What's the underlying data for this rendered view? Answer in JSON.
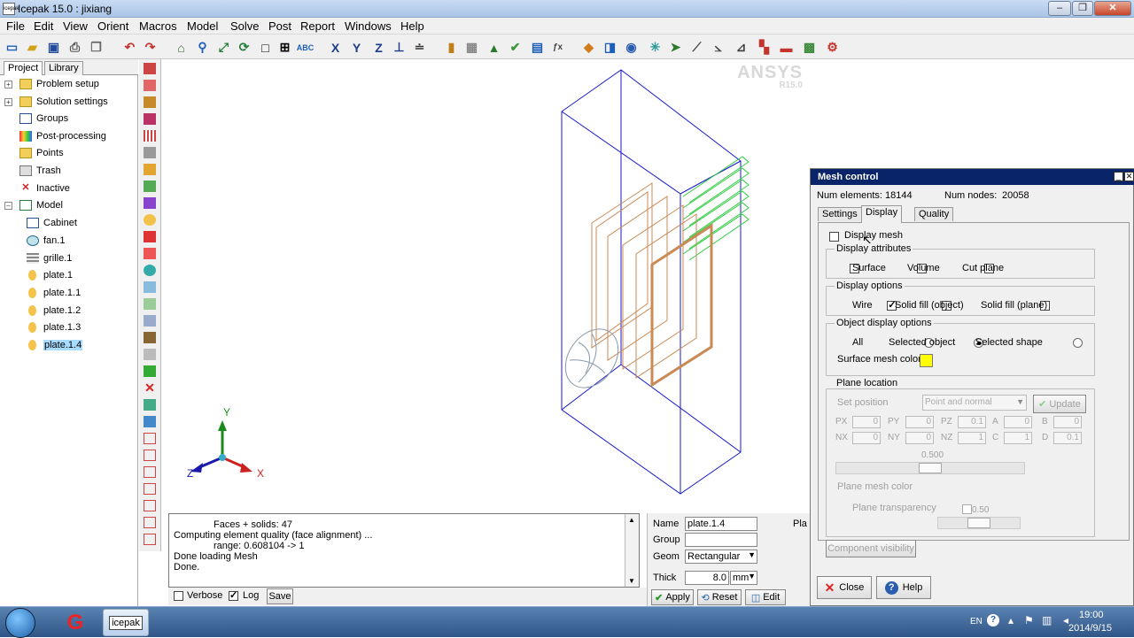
{
  "window": {
    "title": "Icepak 15.0 : jixiang",
    "icon_text": "icepak"
  },
  "menu": [
    "File",
    "Edit",
    "View",
    "Orient",
    "Macros",
    "Model",
    "Solve",
    "Post",
    "Report",
    "Windows",
    "Help"
  ],
  "panel_tabs": {
    "project": "Project",
    "library": "Library"
  },
  "tree": {
    "problem_setup": "Problem setup",
    "solution_settings": "Solution settings",
    "groups": "Groups",
    "post_processing": "Post-processing",
    "points": "Points",
    "trash": "Trash",
    "inactive": "Inactive",
    "model": "Model",
    "children": [
      "Cabinet",
      "fan.1",
      "grille.1",
      "plate.1",
      "plate.1.1",
      "plate.1.2",
      "plate.1.3",
      "plate.1.4"
    ]
  },
  "branding": {
    "name": "ANSYS",
    "version": "R15.0"
  },
  "axes": {
    "x": "X",
    "y": "Y",
    "z": "Z"
  },
  "log": {
    "lines": [
      "Faces + solids: 47",
      "Computing element quality (face alignment) ...",
      "range: 0.608104 -> 1",
      "Done loading Mesh",
      "Done."
    ],
    "verbose": "Verbose",
    "log": "Log",
    "save": "Save"
  },
  "props": {
    "name_label": "Name",
    "name_value": "plate.1.4",
    "group_label": "Group",
    "group_value": "",
    "geom_label": "Geom",
    "geom_value": "Rectangular",
    "thick_label": "Thick",
    "thick_value": "8.0",
    "thick_unit": "mm",
    "apply": "Apply",
    "reset": "Reset",
    "edit": "Edit",
    "plane_cut": "Pla"
  },
  "mesh": {
    "title": "Mesh control",
    "num_elements_label": "Num elements:",
    "num_elements": "18144",
    "num_nodes_label": "Num nodes:",
    "num_nodes": "20058",
    "tabs": [
      "Settings",
      "Display",
      "Quality"
    ],
    "display_mesh": "Display mesh",
    "display_attributes": "Display attributes",
    "surface": "Surface",
    "volume": "Volume",
    "cut_plane": "Cut plane",
    "display_options": "Display options",
    "wire": "Wire",
    "solid_fill_object": "Solid fill (object)",
    "solid_fill_plane": "Solid fill (plane)",
    "object_display_options": "Object display options",
    "all": "All",
    "selected_object": "Selected object",
    "selected_shape": "Selected shape",
    "surface_mesh_color": "Surface mesh color",
    "surface_mesh_color_value": "#ffff00",
    "plane_location": "Plane location",
    "set_position": "Set position",
    "set_position_value": "Point and normal",
    "update": "Update",
    "px": "PX",
    "py": "PY",
    "pz": "PZ",
    "a": "A",
    "b": "B",
    "nx": "NX",
    "ny": "NY",
    "nz": "NZ",
    "c": "C",
    "d": "D",
    "px_v": "0",
    "py_v": "0",
    "pz_v": "0.1",
    "a_v": "0",
    "b_v": "0",
    "nx_v": "0",
    "ny_v": "0",
    "nz_v": "1",
    "c_v": "1",
    "d_v": "0.1",
    "slider_value": "0.500",
    "plane_mesh_color": "Plane mesh color",
    "plane_transparency": "Plane transparency",
    "transparency_value": "0.50",
    "component_visibility": "Component visibility",
    "close": "Close",
    "help": "Help"
  },
  "taskbar": {
    "app": "icepak",
    "lang": "EN",
    "time": "19:00",
    "date": "2014/9/15"
  }
}
